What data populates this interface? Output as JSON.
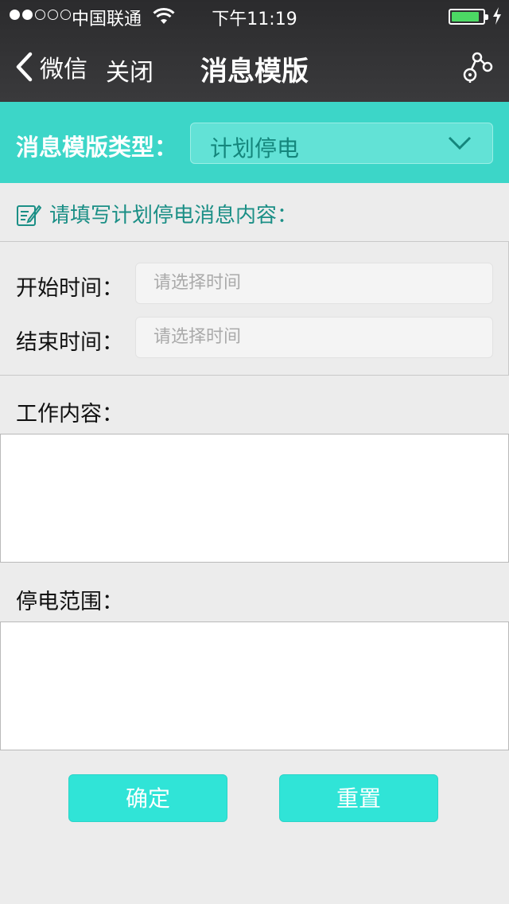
{
  "status": {
    "carrier": "中国联通",
    "time": "下午11:19",
    "signal_bars_filled": 2,
    "signal_bars_total": 5,
    "battery_level": 0.9
  },
  "nav": {
    "back_label": "微信",
    "close_label": "关闭",
    "title": "消息模版"
  },
  "template_type": {
    "label": "消息模版类型：",
    "selected": "计划停电"
  },
  "hint": "请填写计划停电消息内容：",
  "fields": {
    "start_label": "开始时间：",
    "start_placeholder": "请选择时间",
    "end_label": "结束时间：",
    "end_placeholder": "请选择时间",
    "work_label": "工作内容：",
    "range_label": "停电范围："
  },
  "buttons": {
    "confirm": "确定",
    "reset": "重置"
  },
  "colors": {
    "accent": "#3cd6c8",
    "button": "#30e4d7",
    "hint_text": "#1b8f86",
    "battery": "#4cd964"
  }
}
